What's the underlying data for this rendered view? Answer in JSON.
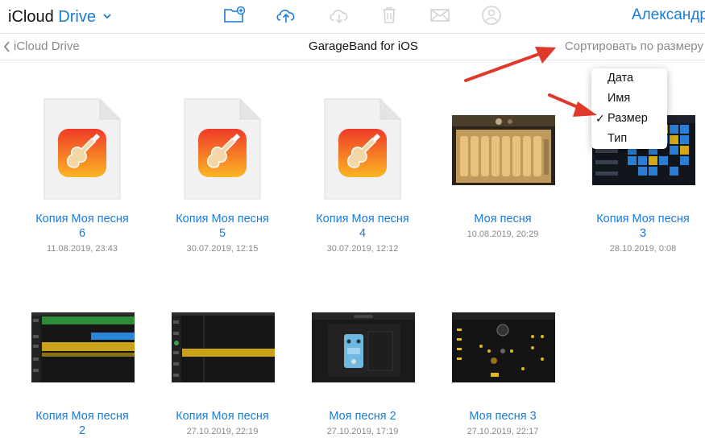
{
  "header": {
    "app_title_part1": "iCloud",
    "app_title_part2": "Drive",
    "user_name": "Александр",
    "toolbar_icons": [
      "new-folder-icon",
      "upload-icon",
      "download-icon",
      "trash-icon",
      "mail-icon",
      "add-person-icon"
    ]
  },
  "subheader": {
    "back_label": "iCloud Drive",
    "folder_title": "GarageBand for iOS",
    "sort_label": "Сортировать по размеру"
  },
  "sort_menu": {
    "items": [
      {
        "label": "Дата",
        "checked": false
      },
      {
        "label": "Имя",
        "checked": false
      },
      {
        "label": "Размер",
        "checked": true
      },
      {
        "label": "Тип",
        "checked": false
      }
    ],
    "check_mark": "✓"
  },
  "files": [
    {
      "name_line1": "Копия Моя песня",
      "name_line2": "6",
      "date": "11.08.2019, 23:43",
      "thumb": "garageband-doc-icon"
    },
    {
      "name_line1": "Копия Моя песня",
      "name_line2": "5",
      "date": "30.07.2019, 12:15",
      "thumb": "garageband-doc-icon"
    },
    {
      "name_line1": "Копия Моя песня",
      "name_line2": "4",
      "date": "30.07.2019, 12:12",
      "thumb": "garageband-doc-icon"
    },
    {
      "name_line1": "Моя песня",
      "name_line2": "",
      "date": "10.08.2019, 20:29",
      "thumb": "xylophone-screenshot"
    },
    {
      "name_line1": "Копия Моя песня",
      "name_line2": "3",
      "date": "28.10.2019, 0:08",
      "thumb": "drum-grid-screenshot"
    },
    {
      "name_line1": "Копия Моя песня",
      "name_line2": "2",
      "date": "",
      "thumb": "tracks-screenshot"
    },
    {
      "name_line1": "Копия Моя песня",
      "name_line2": "",
      "date": "27.10.2019, 22:19",
      "thumb": "tracks-screenshot"
    },
    {
      "name_line1": "Моя песня 2",
      "name_line2": "",
      "date": "27.10.2019, 17:19",
      "thumb": "amp-pedal-screenshot"
    },
    {
      "name_line1": "Моя песня 3",
      "name_line2": "",
      "date": "27.10.2019, 22:17",
      "thumb": "live-loops-screenshot"
    }
  ],
  "colors": {
    "accent": "#1a7bd8",
    "annotation_arrow": "#e0392b",
    "muted": "#8a8a8a"
  }
}
